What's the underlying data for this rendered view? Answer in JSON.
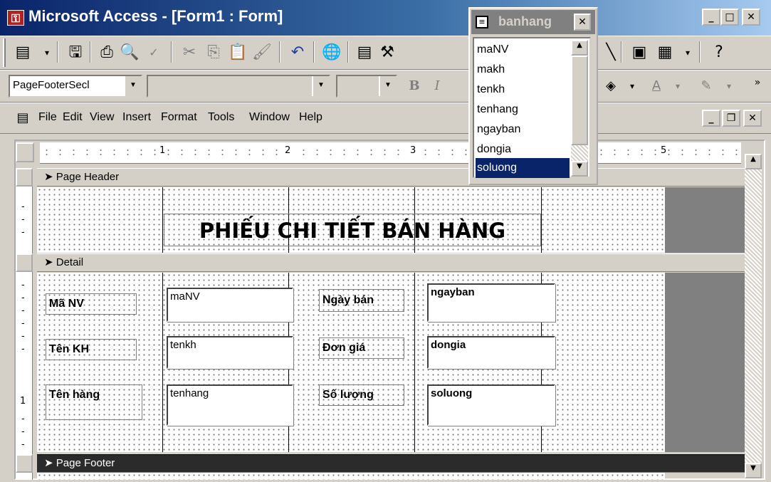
{
  "window": {
    "title": "Microsoft Access - [Form1 : Form]",
    "minimize": "_",
    "maximize": "□",
    "close": "✕"
  },
  "doc_controls": {
    "minimize": "_",
    "restore": "❐",
    "close": "✕"
  },
  "formatting": {
    "object_selector": "PageFooterSecl",
    "font_name": "",
    "font_size": "",
    "bold": "B",
    "italic": "I",
    "font_color": "A"
  },
  "menu": {
    "file": "File",
    "edit": "Edit",
    "view": "View",
    "insert": "Insert",
    "format": "Format",
    "tools": "Tools",
    "window": "Window",
    "help": "Help"
  },
  "ruler": {
    "marks": [
      "1",
      "2",
      "3",
      "5"
    ],
    "vmark": "1"
  },
  "sections": {
    "page_header": "Page Header",
    "detail": "Detail",
    "page_footer": "Page Footer"
  },
  "header_title": "PHIẾU CHI TIẾT BÁN HÀNG",
  "labels": {
    "manv": "Mã NV",
    "tenkh": "Tên KH",
    "tenhang": "Tên hàng",
    "ngayban": "Ngày bán",
    "dongia": "Đơn giá",
    "soluong": "Số lượng"
  },
  "textboxes": {
    "manv": "maNV",
    "tenkh": "tenkh",
    "tenhang": "tenhang",
    "ngayban": "ngayban",
    "dongia": "dongia",
    "soluong": "soluong"
  },
  "field_list": {
    "title": "banhang",
    "close": "✕",
    "items": [
      "maNV",
      "makh",
      "tenkh",
      "tenhang",
      "ngayban",
      "dongia",
      "soluong"
    ],
    "selected": "soluong"
  },
  "colors": {
    "title_bar": "#0a246a",
    "selection": "#0a246a",
    "face": "#d4d0c8"
  },
  "icons": [
    "access-icon",
    "view-icon",
    "save-icon",
    "print-icon",
    "preview-icon",
    "spell-icon",
    "cut-icon",
    "copy-icon",
    "paste-icon",
    "format-painter-icon",
    "undo-icon",
    "hyperlink-icon",
    "properties-icon",
    "build-icon",
    "new-object-icon",
    "help-icon",
    "fill-color-icon",
    "line-color-icon",
    "form-icon"
  ]
}
